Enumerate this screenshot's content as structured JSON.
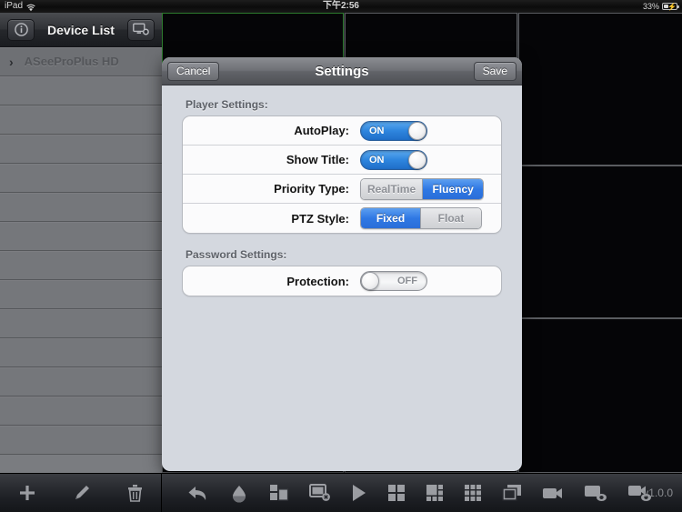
{
  "status_bar": {
    "carrier": "iPad",
    "wifi_icon": "wifi-icon",
    "time": "下午2:56",
    "battery_percent": "33%",
    "battery_level": 33,
    "battery_icon": "battery-charging-icon"
  },
  "sidebar": {
    "info_icon": "info-icon",
    "title": "Device List",
    "settings_icon": "monitor-gear-icon",
    "device": {
      "chevron_icon": "chevron-right-icon",
      "name": "ASeeProPlus HD"
    },
    "empty_row_count": 13
  },
  "video_grid": {
    "columns": [
      {
        "cells": [
          {
            "selected": true
          },
          {
            "selected": false
          },
          {
            "selected": false
          }
        ]
      },
      {
        "cells": [
          {
            "selected": false
          },
          {
            "selected": false
          },
          {
            "selected": false
          }
        ]
      },
      {
        "cells": [
          {
            "selected": false
          },
          {
            "selected": false
          },
          {
            "selected": false
          }
        ]
      }
    ]
  },
  "modal": {
    "navbar": {
      "cancel_label": "Cancel",
      "title": "Settings",
      "save_label": "Save"
    },
    "groups": [
      {
        "header": "Player Settings:",
        "rows": [
          {
            "label": "AutoPlay:",
            "control": "toggle",
            "state": "ON"
          },
          {
            "label": "Show Title:",
            "control": "toggle",
            "state": "ON"
          },
          {
            "label": "Priority Type:",
            "control": "segmented",
            "options": [
              "RealTime",
              "Fluency"
            ],
            "selected": "Fluency"
          },
          {
            "label": "PTZ Style:",
            "control": "segmented",
            "options": [
              "Fixed",
              "Float"
            ],
            "selected": "Fixed"
          }
        ]
      },
      {
        "header": "Password Settings:",
        "rows": [
          {
            "label": "Protection:",
            "control": "toggle",
            "state": "OFF"
          }
        ]
      }
    ]
  },
  "toolbar": {
    "left_icons": [
      "add-icon",
      "edit-icon",
      "delete-icon"
    ],
    "right_icons": [
      "back-arrow-icon",
      "ptz-icon",
      "multi-window-icon",
      "close-window-icon",
      "play-icon",
      "grid-4-icon",
      "grid-6-icon",
      "grid-9-icon",
      "single-screen-icon",
      "record-icon",
      "snapshot-playback-icon",
      "record-playback-icon"
    ],
    "version": "v1.0.0"
  },
  "colors": {
    "accent_blue": "#2f78e4",
    "toggle_on": "#2e85de",
    "selection_green": "#2d7a2d",
    "modal_bg": "#d4d8df",
    "sidebar_bg": "#7a7c80"
  }
}
